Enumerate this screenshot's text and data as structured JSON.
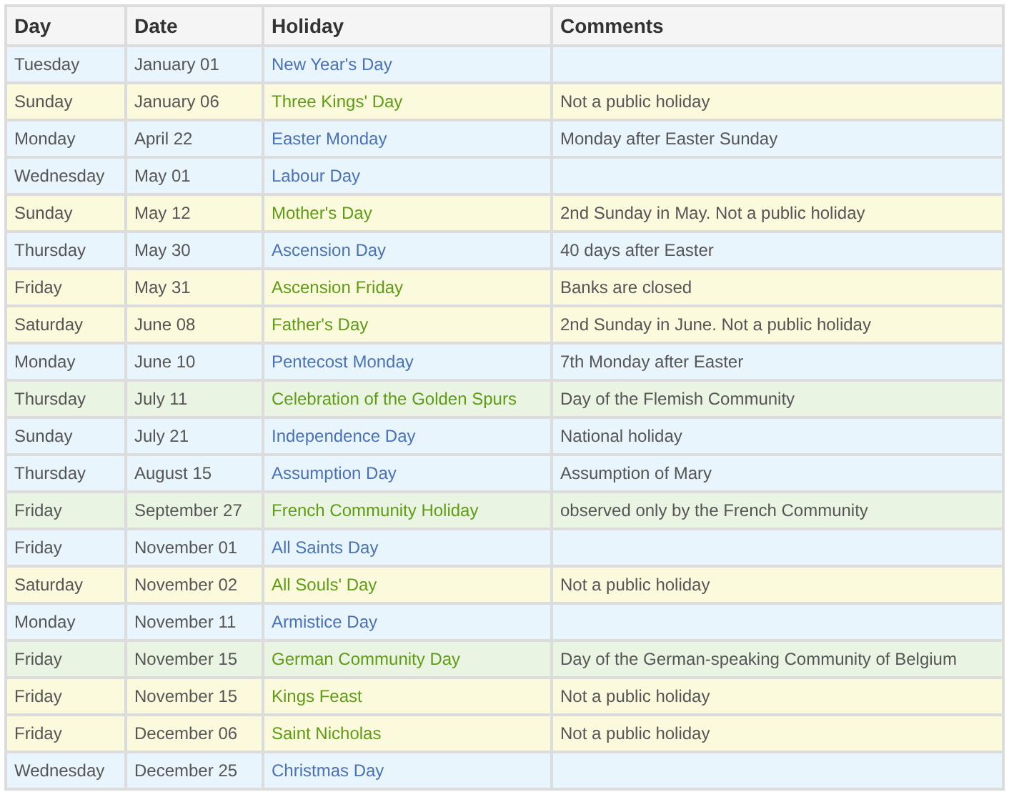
{
  "table": {
    "columns": [
      "Day",
      "Date",
      "Holiday",
      "Comments"
    ],
    "rows": [
      {
        "kind": "public",
        "day": "Tuesday",
        "date": "January 01",
        "holiday": "New Year's Day",
        "comment": ""
      },
      {
        "kind": "observance",
        "day": "Sunday",
        "date": "January 06",
        "holiday": "Three Kings' Day",
        "comment": "Not a public holiday"
      },
      {
        "kind": "public",
        "day": "Monday",
        "date": "April 22",
        "holiday": "Easter Monday",
        "comment": "Monday after Easter Sunday"
      },
      {
        "kind": "public",
        "day": "Wednesday",
        "date": "May 01",
        "holiday": "Labour Day",
        "comment": ""
      },
      {
        "kind": "observance",
        "day": "Sunday",
        "date": "May 12",
        "holiday": "Mother's Day",
        "comment": "2nd Sunday in May. Not a public holiday"
      },
      {
        "kind": "public",
        "day": "Thursday",
        "date": "May 30",
        "holiday": "Ascension Day",
        "comment": "40 days after Easter"
      },
      {
        "kind": "observance",
        "day": "Friday",
        "date": "May 31",
        "holiday": "Ascension Friday",
        "comment": "Banks are closed"
      },
      {
        "kind": "observance",
        "day": "Saturday",
        "date": "June 08",
        "holiday": "Father's Day",
        "comment": "2nd Sunday in June. Not a public holiday"
      },
      {
        "kind": "public",
        "day": "Monday",
        "date": "June 10",
        "holiday": "Pentecost Monday",
        "comment": "7th Monday after Easter"
      },
      {
        "kind": "regional",
        "day": "Thursday",
        "date": "July 11",
        "holiday": "Celebration of the Golden Spurs",
        "comment": "Day of the Flemish Community"
      },
      {
        "kind": "public",
        "day": "Sunday",
        "date": "July 21",
        "holiday": "Independence Day",
        "comment": "National holiday"
      },
      {
        "kind": "public",
        "day": "Thursday",
        "date": "August 15",
        "holiday": "Assumption Day",
        "comment": "Assumption of Mary"
      },
      {
        "kind": "regional",
        "day": "Friday",
        "date": "September 27",
        "holiday": "French Community Holiday",
        "comment": "observed only by the French Community"
      },
      {
        "kind": "public",
        "day": "Friday",
        "date": "November 01",
        "holiday": "All Saints Day",
        "comment": ""
      },
      {
        "kind": "observance",
        "day": "Saturday",
        "date": "November 02",
        "holiday": "All Souls' Day",
        "comment": "Not a public holiday"
      },
      {
        "kind": "public",
        "day": "Monday",
        "date": "November 11",
        "holiday": "Armistice Day",
        "comment": ""
      },
      {
        "kind": "regional",
        "day": "Friday",
        "date": "November 15",
        "holiday": "German Community Day",
        "comment": "Day of the German-speaking Community of Belgium"
      },
      {
        "kind": "observance",
        "day": "Friday",
        "date": "November 15",
        "holiday": "Kings Feast",
        "comment": "Not a public holiday"
      },
      {
        "kind": "observance",
        "day": "Friday",
        "date": "December 06",
        "holiday": "Saint Nicholas",
        "comment": "Not a public holiday"
      },
      {
        "kind": "public",
        "day": "Wednesday",
        "date": "December 25",
        "holiday": "Christmas Day",
        "comment": ""
      }
    ]
  }
}
